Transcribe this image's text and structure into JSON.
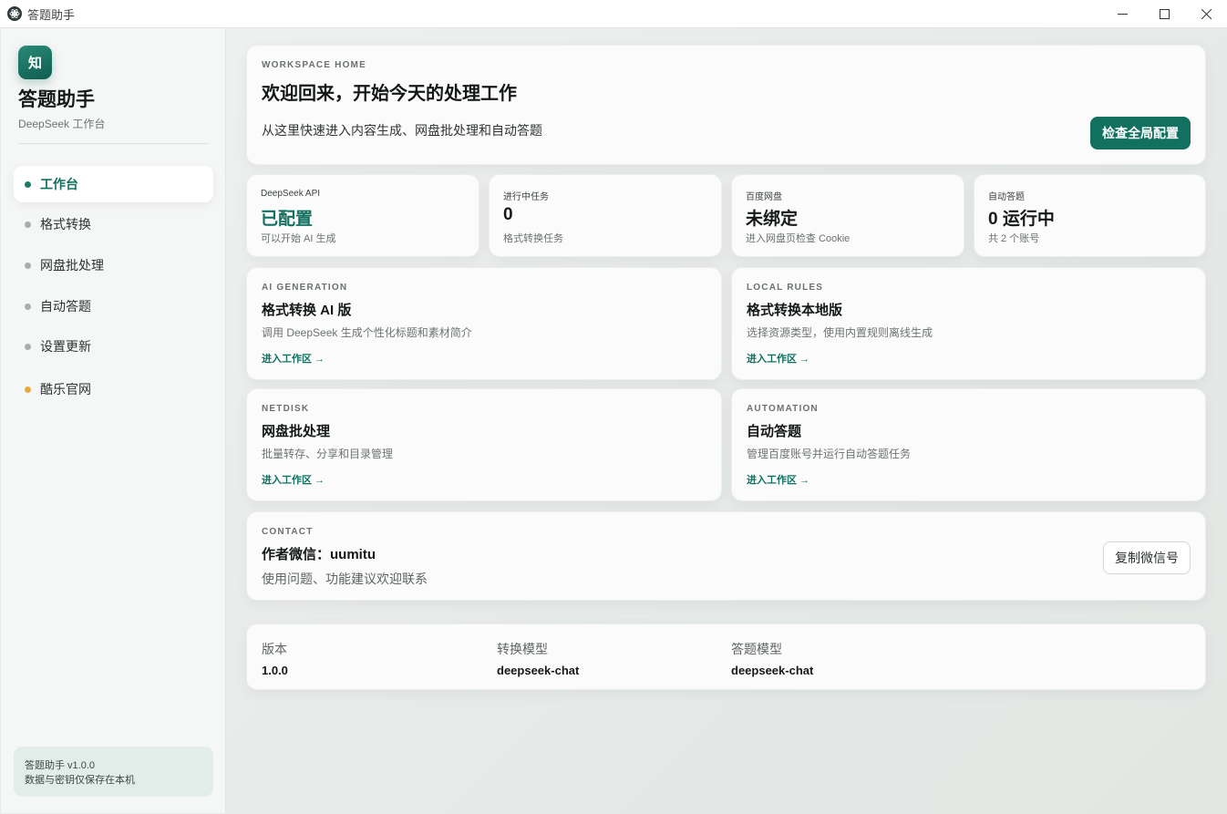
{
  "window": {
    "title": "答题助手"
  },
  "sidebar": {
    "logo_char": "知",
    "brand_name": "答题助手",
    "brand_sub": "DeepSeek 工作台",
    "items": [
      {
        "label": "工作台",
        "active": true
      },
      {
        "label": "格式转换"
      },
      {
        "label": "网盘批处理"
      },
      {
        "label": "自动答题"
      },
      {
        "label": "设置更新"
      },
      {
        "label": "酷乐官网",
        "dot_color": "#eca73b"
      }
    ],
    "footer_line1": "答题助手 v1.0.0",
    "footer_line2": "数据与密钥仅保存在本机"
  },
  "hero": {
    "eyebrow": "WORKSPACE HOME",
    "title": "欢迎回来，开始今天的处理工作",
    "desc": "从这里快速进入内容生成、网盘批处理和自动答题",
    "button": "检查全局配置"
  },
  "stats": [
    {
      "label": "DeepSeek API",
      "value": "已配置",
      "sub": "可以开始 AI 生成"
    },
    {
      "label": "进行中任务",
      "value": "0",
      "sub": "格式转换任务"
    },
    {
      "label": "百度网盘",
      "value": "未绑定",
      "sub": "进入网盘页检查 Cookie"
    },
    {
      "label": "自动答题",
      "value": "0 运行中",
      "sub": "共 2 个账号"
    }
  ],
  "features": [
    {
      "eyebrow": "AI GENERATION",
      "title": "格式转换 AI 版",
      "desc": "调用 DeepSeek 生成个性化标题和素材简介",
      "link": "进入工作区 →"
    },
    {
      "eyebrow": "LOCAL RULES",
      "title": "格式转换本地版",
      "desc": "选择资源类型，使用内置规则离线生成",
      "link": "进入工作区 →"
    },
    {
      "eyebrow": "NETDISK",
      "title": "网盘批处理",
      "desc": "批量转存、分享和目录管理",
      "link": "进入工作区 →"
    },
    {
      "eyebrow": "AUTOMATION",
      "title": "自动答题",
      "desc": "管理百度账号并运行自动答题任务",
      "link": "进入工作区 →"
    }
  ],
  "contact": {
    "eyebrow": "CONTACT",
    "title": "作者微信：uumitu",
    "desc": "使用问题、功能建议欢迎联系",
    "button": "复制微信号"
  },
  "info": [
    {
      "label": "版本",
      "value": "1.0.0"
    },
    {
      "label": "转换模型",
      "value": "deepseek-chat"
    },
    {
      "label": "答题模型",
      "value": "deepseek-chat"
    }
  ],
  "colors": {
    "accent": "#137060",
    "accent_dark": "#12705f",
    "warning_dot": "#eca73b"
  }
}
